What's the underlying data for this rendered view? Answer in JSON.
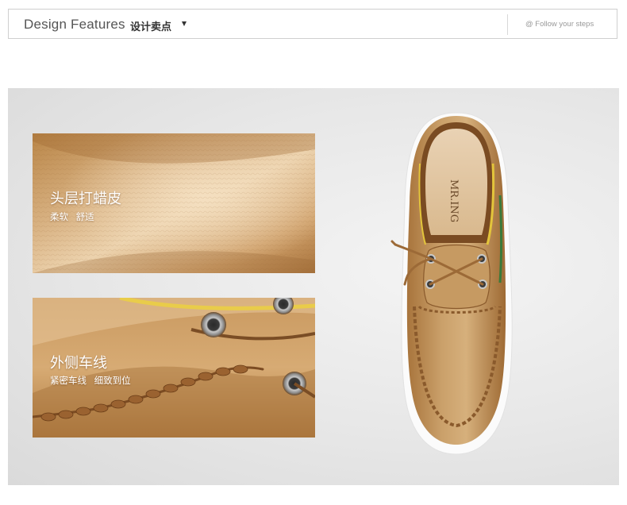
{
  "header": {
    "title": "Design Features",
    "title_cn": "设计卖点",
    "follow": "@ Follow your steps"
  },
  "features": [
    {
      "title": "头层打蜡皮",
      "subtitle": "柔软 舒适"
    },
    {
      "title": "外侧车线",
      "subtitle": "紧密车线 细致到位"
    }
  ],
  "insole_brand": "MR.ING",
  "colors": {
    "leather": "#c39a62",
    "leather_dark": "#8a5a2c",
    "panel_bg": "#e6e6e6",
    "sole": "#ffffff"
  }
}
